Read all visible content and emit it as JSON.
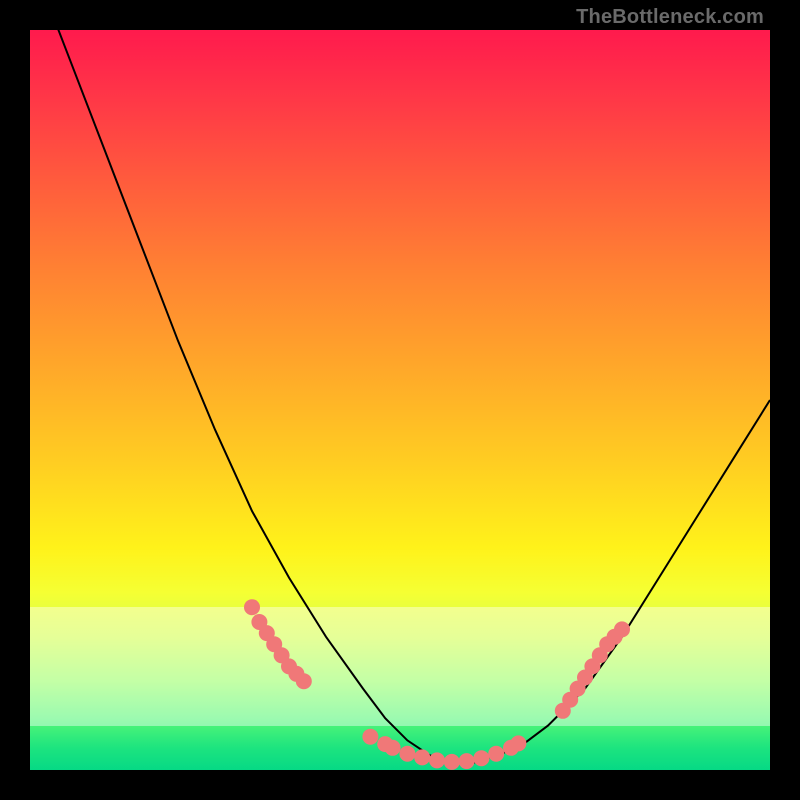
{
  "watermark": "TheBottleneck.com",
  "colors": {
    "curve_stroke": "#000000",
    "dot_fill": "#f07878",
    "dot_stroke": "#e06666"
  },
  "chart_data": {
    "type": "line",
    "title": "",
    "xlabel": "",
    "ylabel": "",
    "xlim": [
      0,
      100
    ],
    "ylim": [
      0,
      100
    ],
    "series": [
      {
        "name": "bottleneck-curve",
        "x": [
          0,
          5,
          10,
          15,
          20,
          25,
          30,
          35,
          40,
          45,
          48,
          51,
          54,
          57,
          60,
          63,
          66,
          70,
          75,
          80,
          85,
          90,
          95,
          100
        ],
        "y": [
          110,
          97,
          84,
          71,
          58,
          46,
          35,
          26,
          18,
          11,
          7,
          4,
          2,
          1,
          1,
          2,
          3,
          6,
          11,
          18,
          26,
          34,
          42,
          50
        ]
      }
    ],
    "dot_clusters": [
      {
        "name": "left-cluster",
        "points": [
          [
            30,
            22
          ],
          [
            31,
            20
          ],
          [
            32,
            18.5
          ],
          [
            33,
            17
          ],
          [
            34,
            15.5
          ],
          [
            35,
            14
          ],
          [
            36,
            13
          ],
          [
            37,
            12
          ]
        ]
      },
      {
        "name": "bottom-cluster",
        "points": [
          [
            46,
            4.5
          ],
          [
            48,
            3.5
          ],
          [
            49,
            3
          ],
          [
            51,
            2.2
          ],
          [
            53,
            1.7
          ],
          [
            55,
            1.3
          ],
          [
            57,
            1.1
          ],
          [
            59,
            1.2
          ],
          [
            61,
            1.6
          ],
          [
            63,
            2.2
          ],
          [
            65,
            3.0
          ],
          [
            66,
            3.6
          ]
        ]
      },
      {
        "name": "right-cluster",
        "points": [
          [
            72,
            8
          ],
          [
            73,
            9.5
          ],
          [
            74,
            11
          ],
          [
            75,
            12.5
          ],
          [
            76,
            14
          ],
          [
            77,
            15.5
          ],
          [
            78,
            17
          ],
          [
            79,
            18
          ],
          [
            80,
            19
          ]
        ]
      }
    ],
    "veil_band": {
      "y_top": 22,
      "y_bottom": 6
    }
  }
}
